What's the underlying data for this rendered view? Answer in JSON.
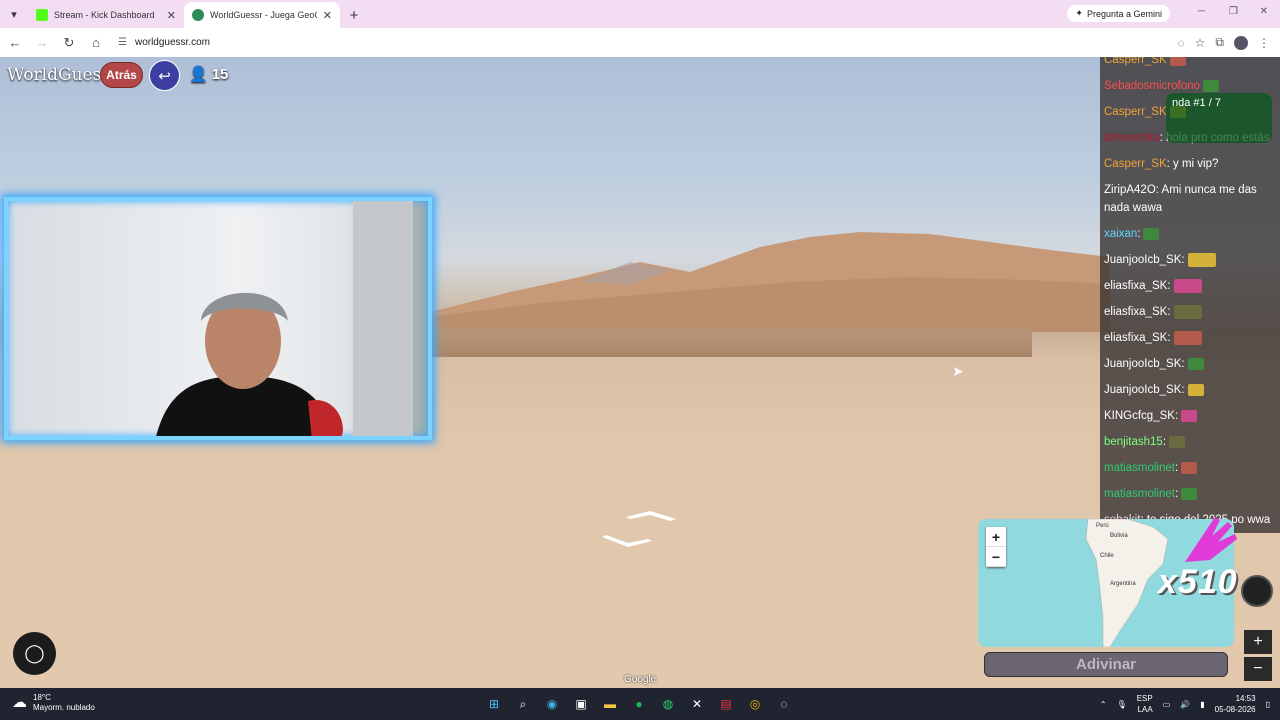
{
  "browser": {
    "tabs": [
      {
        "title": "Stream - Kick Dashboard",
        "favicon_color": "#53fc18",
        "active": false
      },
      {
        "title": "WorldGuessr - Juega GeoGuess",
        "favicon_color": "#2e8b57",
        "active": true
      }
    ],
    "gemini_label": "Pregunta a Gemini",
    "url": "worldguessr.com"
  },
  "game": {
    "brand": "WorldGuessr",
    "back_label": "Atrás",
    "player_count": "15",
    "map_labels": {
      "peru": "Perú",
      "bolivia": "Bolivia",
      "chile": "Chile",
      "argentina": "Argentina"
    },
    "zoom_in": "+",
    "zoom_out": "−",
    "multiplier": "x510",
    "guess_label": "Adivinar",
    "google_label": "Google",
    "round_label": "nda #1 / 7"
  },
  "chat": [
    {
      "user": "Casperr_SK",
      "text": "",
      "color": "#f0a43a",
      "emote": true
    },
    {
      "user": "Sebadosmicrofono",
      "text": "",
      "color": "#ff4d4d",
      "emote": true
    },
    {
      "user": "Casperr_SK",
      "text": "",
      "color": "#f0a43a",
      "emote": true
    },
    {
      "user": "dimesebita",
      "text": ": hola pro como estás",
      "color": "#b11a2b",
      "emote": false
    },
    {
      "user": "Casperr_SK",
      "text": ": y mi vip?",
      "color": "#f0a43a",
      "emote": false
    },
    {
      "user": "ZiripA42O",
      "text": ": Ami nunca me das nada wawa",
      "color": "#ffffff",
      "emote": false
    },
    {
      "user": "xaixan",
      "text": ":",
      "color": "#62d4ff",
      "emote": true
    },
    {
      "user": "JuanjooIcb_SK",
      "text": ":",
      "color": "#ffffff",
      "emote": true
    },
    {
      "user": "eliasfixa_SK",
      "text": ":",
      "color": "#ffffff",
      "emote": true
    },
    {
      "user": "eliasfixa_SK",
      "text": ":",
      "color": "#ffffff",
      "emote": true
    },
    {
      "user": "eliasfixa_SK",
      "text": ":",
      "color": "#ffffff",
      "emote": true
    },
    {
      "user": "JuanjooIcb_SK",
      "text": ":",
      "color": "#ffffff",
      "emote": true
    },
    {
      "user": "JuanjooIcb_SK",
      "text": ":",
      "color": "#ffffff",
      "emote": true
    },
    {
      "user": "KINGcfcg_SK",
      "text": ":",
      "color": "#ffffff",
      "emote": true
    },
    {
      "user": "benjitash15",
      "text": ":",
      "color": "#7cff7c",
      "emote": true
    },
    {
      "user": "matiasmolinet",
      "text": ":",
      "color": "#2ecc71",
      "emote": true
    },
    {
      "user": "matiasmolinet",
      "text": ":",
      "color": "#2ecc71",
      "emote": true
    },
    {
      "user": "sebakit",
      "text": ": te sigo del 2025 po wwa",
      "color": "#dddddd",
      "emote": false
    }
  ],
  "taskbar": {
    "temp": "18°C",
    "weather": "Mayorm. nublado",
    "lang1": "ESP",
    "lang2": "LAA",
    "time": "14:53",
    "date": "05-08-2026"
  }
}
